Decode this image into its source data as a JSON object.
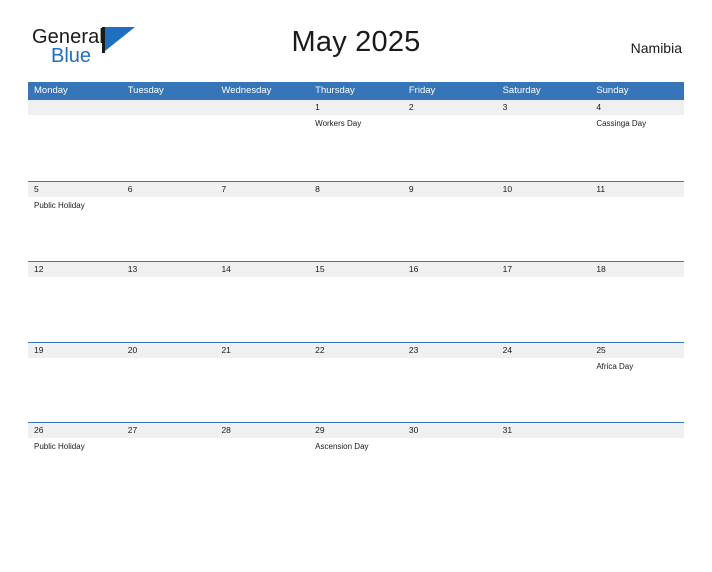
{
  "brand": {
    "name_top": "General",
    "name_bottom": "Blue",
    "accent_color": "#1f6fc0",
    "flag_icon": "flag-icon"
  },
  "header": {
    "title": "May 2025",
    "country": "Namibia"
  },
  "calendar": {
    "header_bg": "#3575b8",
    "band_bg": "#f0f0f0",
    "day_names": [
      "Monday",
      "Tuesday",
      "Wednesday",
      "Thursday",
      "Friday",
      "Saturday",
      "Sunday"
    ],
    "weeks": [
      [
        {
          "date": "",
          "events": []
        },
        {
          "date": "",
          "events": []
        },
        {
          "date": "",
          "events": []
        },
        {
          "date": "1",
          "events": [
            "Workers Day"
          ]
        },
        {
          "date": "2",
          "events": []
        },
        {
          "date": "3",
          "events": []
        },
        {
          "date": "4",
          "events": [
            "Cassinga Day"
          ]
        }
      ],
      [
        {
          "date": "5",
          "events": [
            "Public Holiday"
          ]
        },
        {
          "date": "6",
          "events": []
        },
        {
          "date": "7",
          "events": []
        },
        {
          "date": "8",
          "events": []
        },
        {
          "date": "9",
          "events": []
        },
        {
          "date": "10",
          "events": []
        },
        {
          "date": "11",
          "events": []
        }
      ],
      [
        {
          "date": "12",
          "events": []
        },
        {
          "date": "13",
          "events": []
        },
        {
          "date": "14",
          "events": []
        },
        {
          "date": "15",
          "events": []
        },
        {
          "date": "16",
          "events": []
        },
        {
          "date": "17",
          "events": []
        },
        {
          "date": "18",
          "events": []
        }
      ],
      [
        {
          "date": "19",
          "events": []
        },
        {
          "date": "20",
          "events": []
        },
        {
          "date": "21",
          "events": []
        },
        {
          "date": "22",
          "events": []
        },
        {
          "date": "23",
          "events": []
        },
        {
          "date": "24",
          "events": []
        },
        {
          "date": "25",
          "events": [
            "Africa Day"
          ]
        }
      ],
      [
        {
          "date": "26",
          "events": [
            "Public Holiday"
          ]
        },
        {
          "date": "27",
          "events": []
        },
        {
          "date": "28",
          "events": []
        },
        {
          "date": "29",
          "events": [
            "Ascension Day"
          ]
        },
        {
          "date": "30",
          "events": []
        },
        {
          "date": "31",
          "events": []
        },
        {
          "date": "",
          "events": []
        }
      ]
    ]
  }
}
